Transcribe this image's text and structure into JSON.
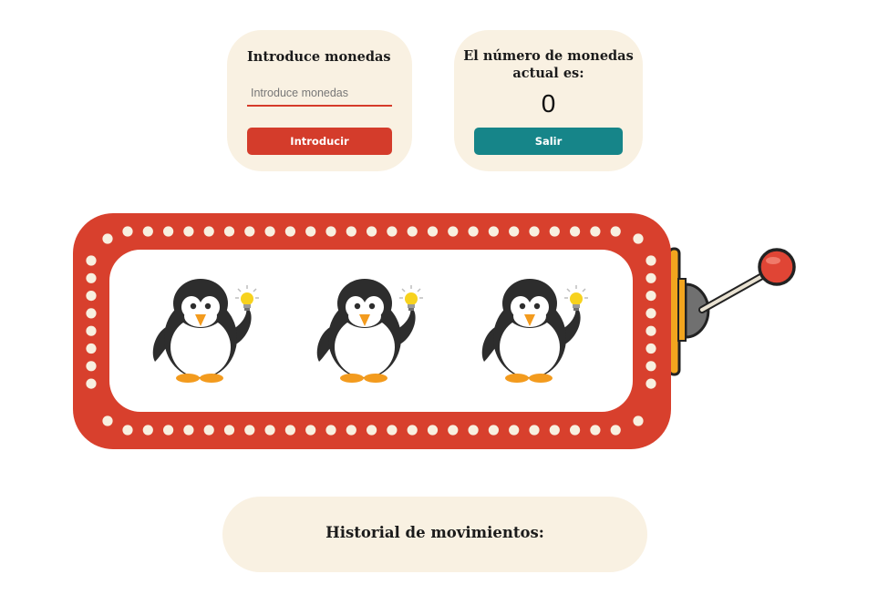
{
  "coin_panel": {
    "title": "Introduce monedas",
    "input_placeholder": "Introduce monedas",
    "input_value": "",
    "button_label": "Introducir"
  },
  "count_panel": {
    "title_line1": "El número de monedas",
    "title_line2": "actual es:",
    "value": "0",
    "button_label": "Salir"
  },
  "slot_machine": {
    "reels": [
      {
        "symbol": "penguin-with-lightbulb-icon"
      },
      {
        "symbol": "penguin-with-lightbulb-icon"
      },
      {
        "symbol": "penguin-with-lightbulb-icon"
      }
    ],
    "frame_color": "#d8402d",
    "bulb_color": "#f8f0e0",
    "lever_knob_color": "#e04535"
  },
  "history": {
    "title": "Historial de movimientos:"
  },
  "colors": {
    "panel_bg": "#f9f1e2",
    "insert_button": "#d43c2b",
    "exit_button": "#168589"
  }
}
